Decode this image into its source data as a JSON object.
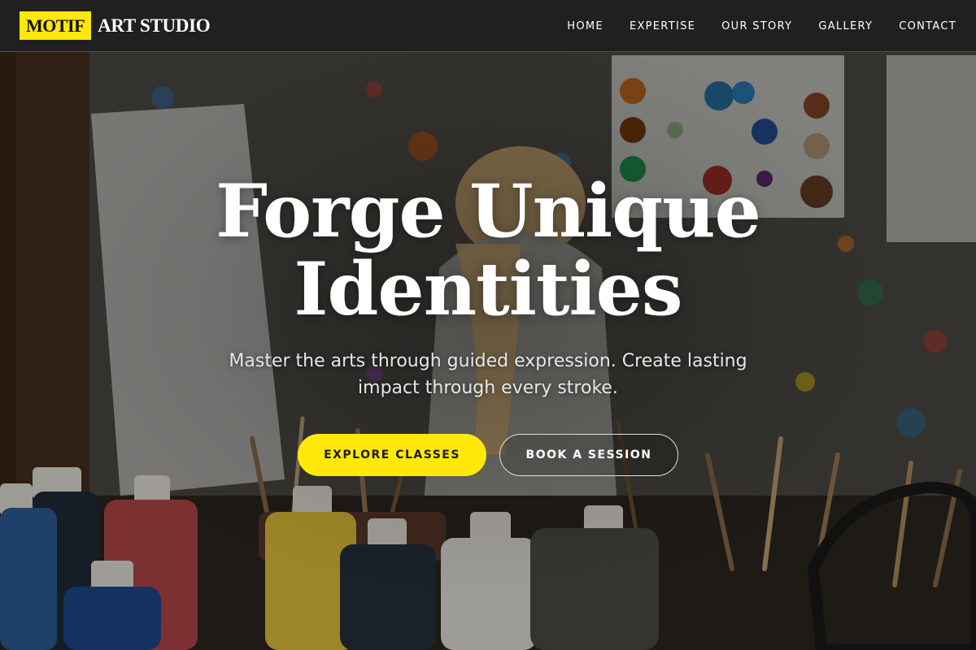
{
  "nav": {
    "logo_box": "MOTIF",
    "logo_text": "ART STUDIO",
    "items": [
      {
        "label": "HOME"
      },
      {
        "label": "EXPERTISE"
      },
      {
        "label": "OUR STORY"
      },
      {
        "label": "GALLERY"
      },
      {
        "label": "CONTACT"
      }
    ]
  },
  "hero": {
    "headline_line1": "Forge Unique",
    "headline_line2": "Identities",
    "subtitle": "Master the arts through guided expression. Create lasting impact through every stroke.",
    "primary_button": "EXPLORE CLASSES",
    "secondary_button": "BOOK A SESSION",
    "background_image": "art-studio-photo"
  },
  "colors": {
    "accent": "#ffe80a",
    "nav_bg": "#202020",
    "text": "#ffffff"
  }
}
